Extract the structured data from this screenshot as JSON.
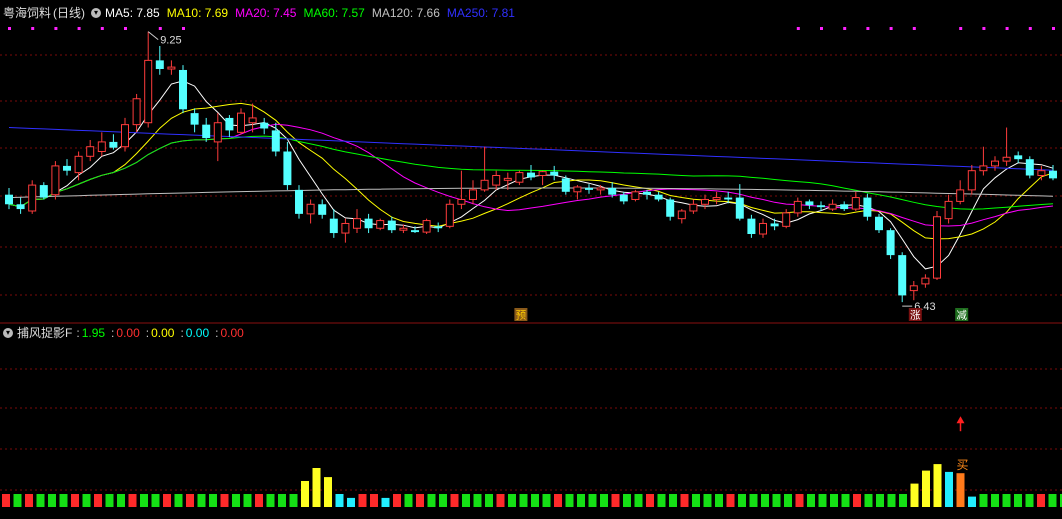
{
  "main_panel": {
    "stock_name": "粤海饲料",
    "period": "(日线)",
    "ma_legend": [
      {
        "label": "MA5: 7.85",
        "color": "#ffffff"
      },
      {
        "label": "MA10: 7.69",
        "color": "#ffff00"
      },
      {
        "label": "MA20: 7.45",
        "color": "#ff00ff"
      },
      {
        "label": "MA60: 7.57",
        "color": "#00ff00"
      },
      {
        "label": "MA120: 7.66",
        "color": "#c0c0c0"
      },
      {
        "label": "MA250: 7.81",
        "color": "#3030ff"
      }
    ],
    "high_label": "9.25",
    "low_label": "6.43",
    "markers": [
      {
        "text": "预",
        "index": 44,
        "bg": "#8a5a1a",
        "fg": "#ffcc00"
      },
      {
        "text": "涨",
        "index": 78,
        "bg": "#7a1010",
        "fg": "#ffffff"
      },
      {
        "text": "减",
        "index": 82,
        "bg": "#1f6e1f",
        "fg": "#ffffff"
      }
    ]
  },
  "sub_panel": {
    "indicator_name": "捕风捉影F",
    "values": [
      {
        "label": "1.95",
        "color": "#00ff00"
      },
      {
        "label": "0.00",
        "color": "#ff3030"
      },
      {
        "label": "0.00",
        "color": "#ffff00"
      },
      {
        "label": "0.00",
        "color": "#00ffff"
      },
      {
        "label": "0.00",
        "color": "#ff3030"
      }
    ],
    "buy_label": "买"
  },
  "chart_data": [
    {
      "type": "candlestick",
      "ohlc": [
        [
          7.55,
          7.62,
          7.4,
          7.45
        ],
        [
          7.45,
          7.52,
          7.35,
          7.4
        ],
        [
          7.38,
          7.7,
          7.35,
          7.65
        ],
        [
          7.65,
          7.68,
          7.5,
          7.52
        ],
        [
          7.55,
          7.9,
          7.5,
          7.85
        ],
        [
          7.85,
          7.92,
          7.75,
          7.8
        ],
        [
          7.78,
          8.0,
          7.7,
          7.95
        ],
        [
          7.95,
          8.12,
          7.9,
          8.05
        ],
        [
          8.0,
          8.2,
          7.95,
          8.1
        ],
        [
          8.1,
          8.18,
          8.02,
          8.04
        ],
        [
          8.05,
          8.35,
          8.0,
          8.28
        ],
        [
          8.28,
          8.6,
          8.2,
          8.55
        ],
        [
          8.3,
          9.25,
          8.25,
          8.95
        ],
        [
          8.95,
          9.1,
          8.8,
          8.86
        ],
        [
          8.86,
          8.95,
          8.8,
          8.88
        ],
        [
          8.85,
          8.9,
          8.4,
          8.44
        ],
        [
          8.4,
          8.45,
          8.2,
          8.28
        ],
        [
          8.28,
          8.35,
          8.1,
          8.14
        ],
        [
          8.1,
          8.4,
          7.9,
          8.3
        ],
        [
          8.35,
          8.38,
          8.15,
          8.22
        ],
        [
          8.2,
          8.45,
          8.18,
          8.4
        ],
        [
          8.3,
          8.5,
          8.2,
          8.35
        ],
        [
          8.3,
          8.35,
          8.18,
          8.24
        ],
        [
          8.22,
          8.3,
          7.95,
          8.0
        ],
        [
          8.0,
          8.1,
          7.6,
          7.65
        ],
        [
          7.6,
          7.65,
          7.3,
          7.35
        ],
        [
          7.35,
          7.5,
          7.25,
          7.45
        ],
        [
          7.45,
          7.5,
          7.3,
          7.34
        ],
        [
          7.3,
          7.4,
          7.1,
          7.15
        ],
        [
          7.15,
          7.3,
          7.05,
          7.25
        ],
        [
          7.2,
          7.4,
          7.15,
          7.3
        ],
        [
          7.3,
          7.35,
          7.15,
          7.2
        ],
        [
          7.2,
          7.3,
          7.18,
          7.28
        ],
        [
          7.28,
          7.32,
          7.15,
          7.18
        ],
        [
          7.18,
          7.24,
          7.15,
          7.2
        ],
        [
          7.18,
          7.22,
          7.15,
          7.16
        ],
        [
          7.16,
          7.3,
          7.14,
          7.28
        ],
        [
          7.22,
          7.26,
          7.16,
          7.2
        ],
        [
          7.22,
          7.5,
          7.2,
          7.45
        ],
        [
          7.45,
          7.8,
          7.4,
          7.5
        ],
        [
          7.5,
          7.7,
          7.45,
          7.6
        ],
        [
          7.6,
          8.05,
          7.58,
          7.7
        ],
        [
          7.65,
          7.8,
          7.6,
          7.75
        ],
        [
          7.7,
          7.78,
          7.6,
          7.72
        ],
        [
          7.68,
          7.8,
          7.65,
          7.78
        ],
        [
          7.78,
          7.86,
          7.7,
          7.73
        ],
        [
          7.75,
          7.8,
          7.65,
          7.79
        ],
        [
          7.79,
          7.85,
          7.7,
          7.75
        ],
        [
          7.72,
          7.75,
          7.55,
          7.58
        ],
        [
          7.58,
          7.65,
          7.5,
          7.63
        ],
        [
          7.62,
          7.66,
          7.56,
          7.6
        ],
        [
          7.6,
          7.65,
          7.55,
          7.62
        ],
        [
          7.62,
          7.68,
          7.52,
          7.55
        ],
        [
          7.55,
          7.58,
          7.45,
          7.48
        ],
        [
          7.5,
          7.6,
          7.48,
          7.58
        ],
        [
          7.58,
          7.6,
          7.5,
          7.55
        ],
        [
          7.55,
          7.58,
          7.48,
          7.5
        ],
        [
          7.5,
          7.52,
          7.28,
          7.32
        ],
        [
          7.3,
          7.4,
          7.25,
          7.38
        ],
        [
          7.38,
          7.5,
          7.35,
          7.45
        ],
        [
          7.45,
          7.55,
          7.4,
          7.5
        ],
        [
          7.5,
          7.58,
          7.45,
          7.52
        ],
        [
          7.52,
          7.58,
          7.46,
          7.5
        ],
        [
          7.52,
          7.66,
          7.28,
          7.3
        ],
        [
          7.3,
          7.34,
          7.1,
          7.14
        ],
        [
          7.14,
          7.3,
          7.1,
          7.25
        ],
        [
          7.25,
          7.3,
          7.18,
          7.22
        ],
        [
          7.22,
          7.4,
          7.2,
          7.36
        ],
        [
          7.36,
          7.52,
          7.32,
          7.48
        ],
        [
          7.48,
          7.5,
          7.4,
          7.44
        ],
        [
          7.44,
          7.48,
          7.38,
          7.42
        ],
        [
          7.4,
          7.5,
          7.38,
          7.45
        ],
        [
          7.45,
          7.48,
          7.38,
          7.4
        ],
        [
          7.4,
          7.58,
          7.38,
          7.52
        ],
        [
          7.52,
          7.56,
          7.28,
          7.32
        ],
        [
          7.32,
          7.35,
          7.15,
          7.18
        ],
        [
          7.18,
          7.2,
          6.88,
          6.92
        ],
        [
          6.92,
          6.95,
          6.43,
          6.5
        ],
        [
          6.55,
          6.65,
          6.45,
          6.6
        ],
        [
          6.62,
          6.72,
          6.58,
          6.68
        ],
        [
          6.68,
          7.38,
          6.66,
          7.32
        ],
        [
          7.3,
          7.55,
          7.25,
          7.48
        ],
        [
          7.48,
          7.7,
          7.45,
          7.6
        ],
        [
          7.6,
          7.86,
          7.55,
          7.8
        ],
        [
          7.8,
          8.05,
          7.75,
          7.85
        ],
        [
          7.85,
          7.95,
          7.8,
          7.9
        ],
        [
          7.9,
          8.25,
          7.85,
          7.94
        ],
        [
          7.96,
          8.0,
          7.88,
          7.92
        ],
        [
          7.92,
          7.95,
          7.72,
          7.75
        ],
        [
          7.75,
          7.85,
          7.7,
          7.8
        ],
        [
          7.8,
          7.86,
          7.7,
          7.72
        ]
      ],
      "high_label": "9.25",
      "low_label": "6.43"
    },
    {
      "type": "bar",
      "title": "捕风捉影F",
      "bar_colors": [
        "r",
        "g",
        "r",
        "g",
        "g",
        "g",
        "r",
        "g",
        "r",
        "g",
        "g",
        "r",
        "g",
        "g",
        "r",
        "g",
        "r",
        "g",
        "g",
        "r",
        "g",
        "g",
        "r",
        "g",
        "g",
        "g",
        "y",
        "y",
        "y",
        "c",
        "c",
        "r",
        "r",
        "c",
        "r",
        "g",
        "r",
        "g",
        "g",
        "r",
        "g",
        "g",
        "g",
        "r",
        "g",
        "g",
        "g",
        "g",
        "r",
        "g",
        "g",
        "g",
        "g",
        "r",
        "g",
        "g",
        "r",
        "g",
        "g",
        "r",
        "g",
        "g",
        "g",
        "r",
        "g",
        "g",
        "g",
        "g",
        "g",
        "r",
        "g",
        "g",
        "g",
        "g",
        "r",
        "g",
        "g",
        "g",
        "g",
        "y",
        "y",
        "y",
        "c",
        "o",
        "c",
        "g",
        "g",
        "g",
        "g",
        "g",
        "r",
        "g",
        "g",
        "g",
        "r",
        "g",
        "g",
        "r",
        "g"
      ],
      "bar_heights": [
        1,
        1,
        1,
        1,
        1,
        1,
        1,
        1,
        1,
        1,
        1,
        1,
        1,
        1,
        1,
        1,
        1,
        1,
        1,
        1,
        1,
        1,
        1,
        1,
        1,
        1,
        2,
        3,
        2.3,
        1,
        0.7,
        1,
        1,
        0.7,
        1,
        1,
        1,
        1,
        1,
        1,
        1,
        1,
        1,
        1,
        1,
        1,
        1,
        1,
        1,
        1,
        1,
        1,
        1,
        1,
        1,
        1,
        1,
        1,
        1,
        1,
        1,
        1,
        1,
        1,
        1,
        1,
        1,
        1,
        1,
        1,
        1,
        1,
        1,
        1,
        1,
        1,
        1,
        1,
        1,
        1.8,
        2.8,
        3.3,
        2.7,
        2.6,
        0.8,
        1,
        1,
        1,
        1,
        1,
        1,
        1,
        1,
        1,
        1,
        1,
        1,
        1,
        1
      ]
    }
  ]
}
